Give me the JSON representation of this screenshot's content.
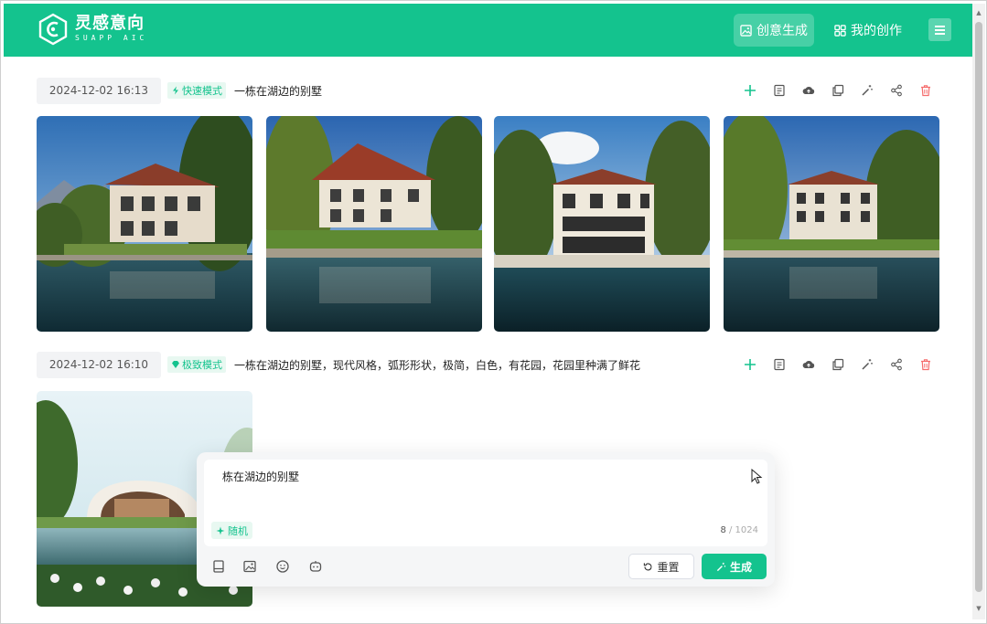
{
  "header": {
    "logo_main": "灵感意向",
    "logo_sub": "SUAPP AIC",
    "nav_create": "创意生成",
    "nav_mine": "我的创作",
    "accent": "#14c38e"
  },
  "records": [
    {
      "date": "2024-12-02 16:13",
      "mode": "快速模式",
      "prompt": "一栋在湖边的别墅",
      "image_count": 4
    },
    {
      "date": "2024-12-02 16:10",
      "mode": "极致模式",
      "prompt": "一栋在湖边的别墅，现代风格，弧形形状，极简，白色，有花园，花园里种满了鲜花",
      "image_count": 1
    }
  ],
  "actions": [
    "plus-icon",
    "document-icon",
    "cloud-upload-icon",
    "copy-icon",
    "magic-wand-icon",
    "share-icon",
    "delete-icon"
  ],
  "input_panel": {
    "text": "栋在湖边的别墅",
    "random_label": "随机",
    "count": "8",
    "max": "/ 1024",
    "reset_label": "重置",
    "generate_label": "生成"
  }
}
